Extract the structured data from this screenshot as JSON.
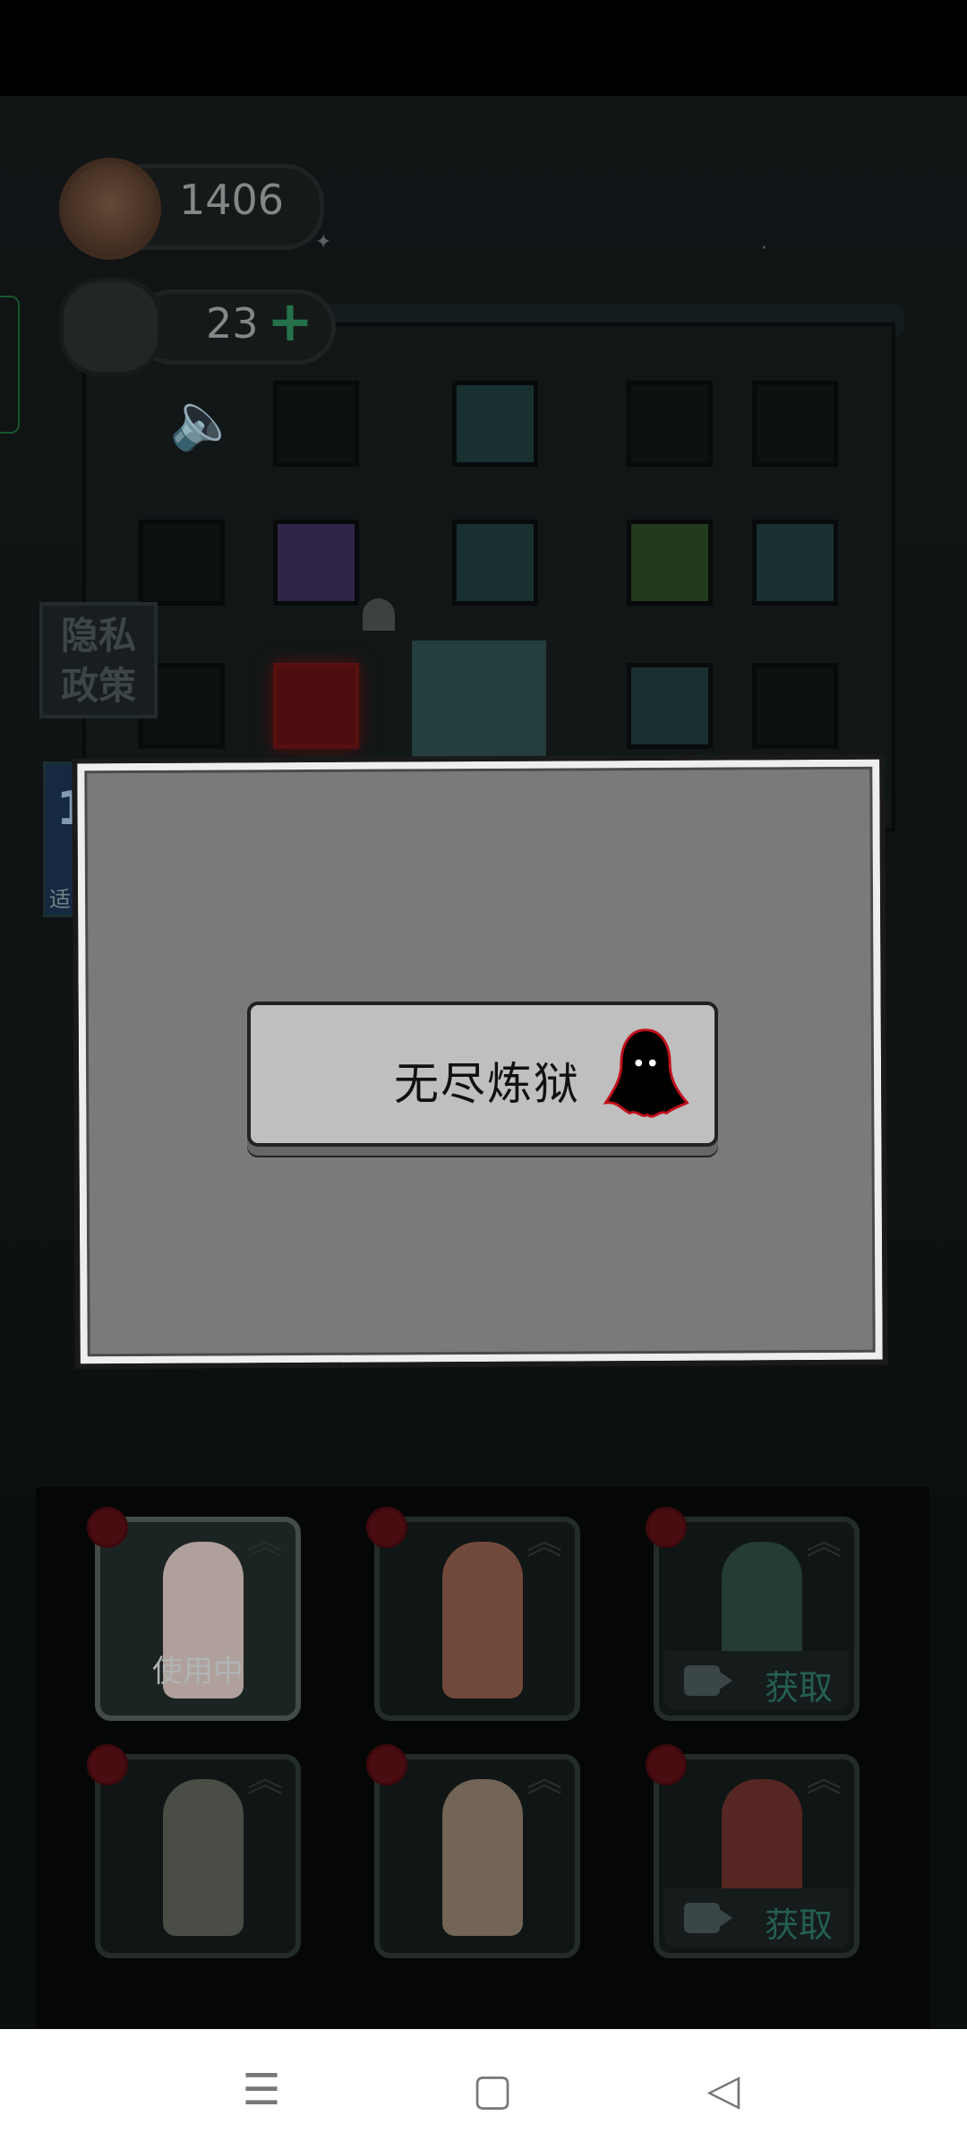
{
  "hud": {
    "coins": "1406",
    "coin_icon": "coin-icon",
    "energy": "23",
    "energy_icon": "energy-icon",
    "plus": "+",
    "plus_icon": "plus-icon",
    "sound_icon": "speaker-icon"
  },
  "side": {
    "privacy_line1": "隐私",
    "privacy_line2": "政策",
    "level_number": "1",
    "level_text": "适"
  },
  "dialog": {
    "mode_label": "无尽炼狱",
    "mode_icon": "ghost-icon"
  },
  "characters": [
    {
      "status": "使用中",
      "active": true
    },
    {
      "status": ""
    },
    {
      "status": "",
      "get_label": "获取",
      "icon": "video-icon"
    },
    {
      "status": ""
    },
    {
      "status": ""
    },
    {
      "status": "",
      "get_label": "获取",
      "icon": "video-icon"
    }
  ],
  "navbar": {
    "menu_icon": "menu-icon",
    "home_icon": "home-icon",
    "back_icon": "back-icon"
  },
  "colors": {
    "accent_green": "#2e8c5b",
    "badge_red": "#5a0f14",
    "get_teal": "#2c7464"
  }
}
